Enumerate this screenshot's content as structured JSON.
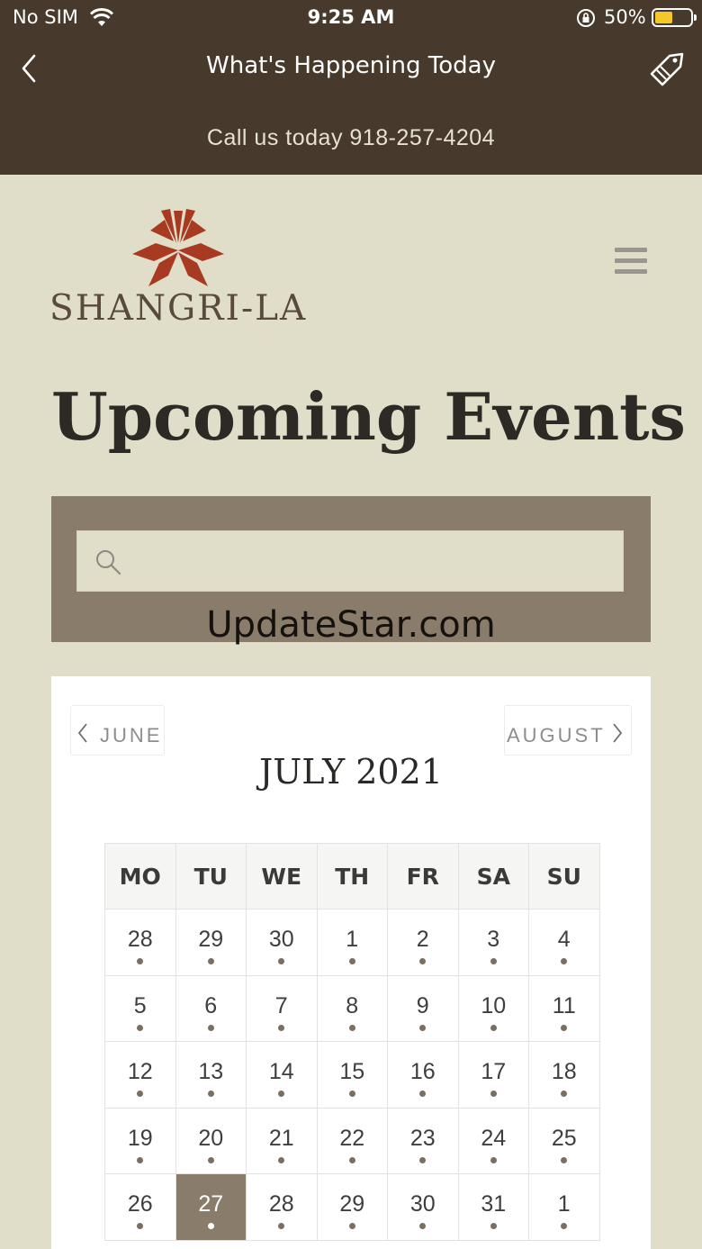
{
  "status_bar": {
    "carrier": "No SIM",
    "time": "9:25 AM",
    "battery_percent": "50%",
    "battery_level": 0.5,
    "battery_color": "#f4c72a"
  },
  "nav": {
    "title": "What's Happening Today",
    "back_icon": "chevron-left-icon",
    "right_icon": "tag-icon"
  },
  "call_bar": {
    "text": "Call us today 918-257-4204"
  },
  "brand": {
    "logo_text": "SHANGRI-LA",
    "logo_color": "#a83a22"
  },
  "page": {
    "title": "Upcoming Events"
  },
  "search": {
    "placeholder": "",
    "value": ""
  },
  "watermark": "UpdateStar.com",
  "calendar": {
    "prev_month": "JUNE",
    "next_month": "AUGUST",
    "month_title": "JULY 2021",
    "weekdays": [
      "MO",
      "TU",
      "WE",
      "TH",
      "FR",
      "SA",
      "SU"
    ],
    "weeks": [
      [
        "28",
        "29",
        "30",
        "1",
        "2",
        "3",
        "4"
      ],
      [
        "5",
        "6",
        "7",
        "8",
        "9",
        "10",
        "11"
      ],
      [
        "12",
        "13",
        "14",
        "15",
        "16",
        "17",
        "18"
      ],
      [
        "19",
        "20",
        "21",
        "22",
        "23",
        "24",
        "25"
      ],
      [
        "26",
        "27",
        "28",
        "29",
        "30",
        "31",
        "1"
      ]
    ],
    "selected_day": "27",
    "accent_color": "#8a7c6b"
  },
  "colors": {
    "header_bg": "#473a2c",
    "page_bg": "#e0ddc8"
  }
}
